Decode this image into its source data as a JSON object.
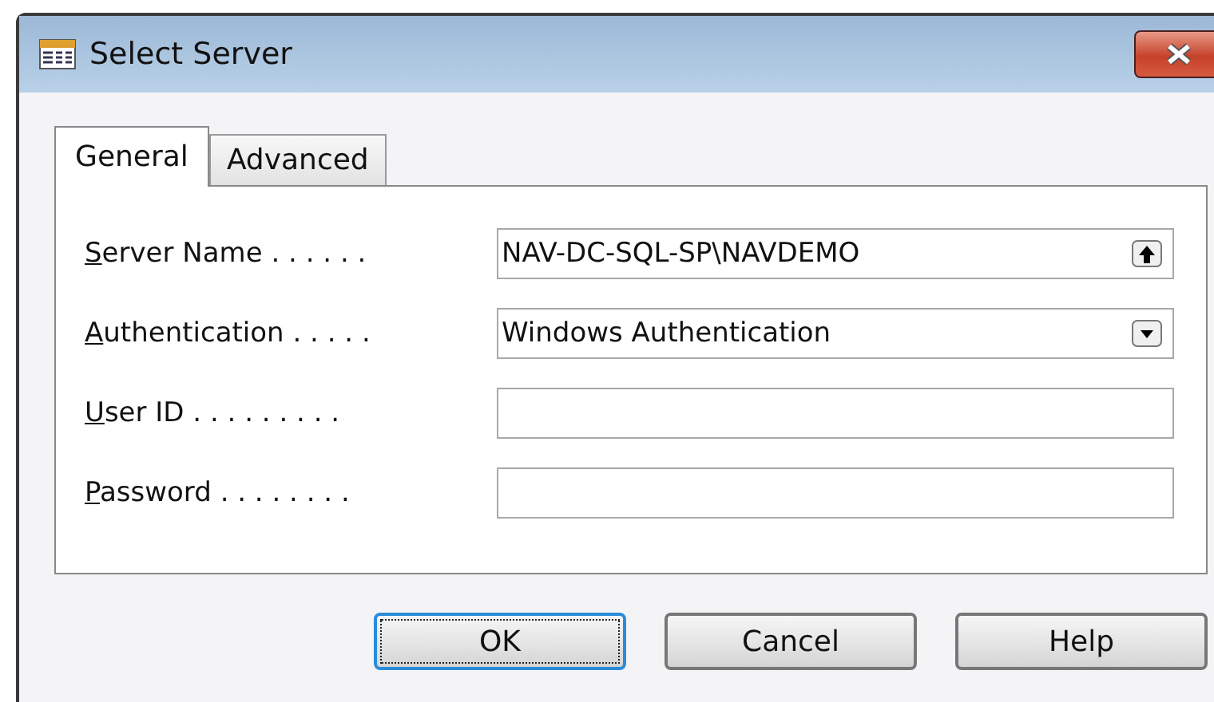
{
  "window": {
    "title": "Select Server"
  },
  "tabs": [
    {
      "label": "General",
      "selected": true
    },
    {
      "label": "Advanced",
      "selected": false
    }
  ],
  "fields": [
    {
      "label": "Server Name . . . . . .",
      "mnemonic": true,
      "kind": "lookup",
      "value": "NAV-DC-SQL-SP\\NAVDEMO"
    },
    {
      "label": "Authentication . . . . .",
      "mnemonic": true,
      "kind": "dropdown",
      "value": "Windows Authentication"
    },
    {
      "label": "User ID . . . . . . . . .",
      "mnemonic": true,
      "kind": "text"
    },
    {
      "label": "Password . . . . . . . .",
      "mnemonic": true,
      "kind": "text"
    }
  ],
  "buttons": [
    {
      "label": "OK",
      "default": true
    },
    {
      "label": "Cancel",
      "default": false
    },
    {
      "label": "Help",
      "default": false
    }
  ]
}
